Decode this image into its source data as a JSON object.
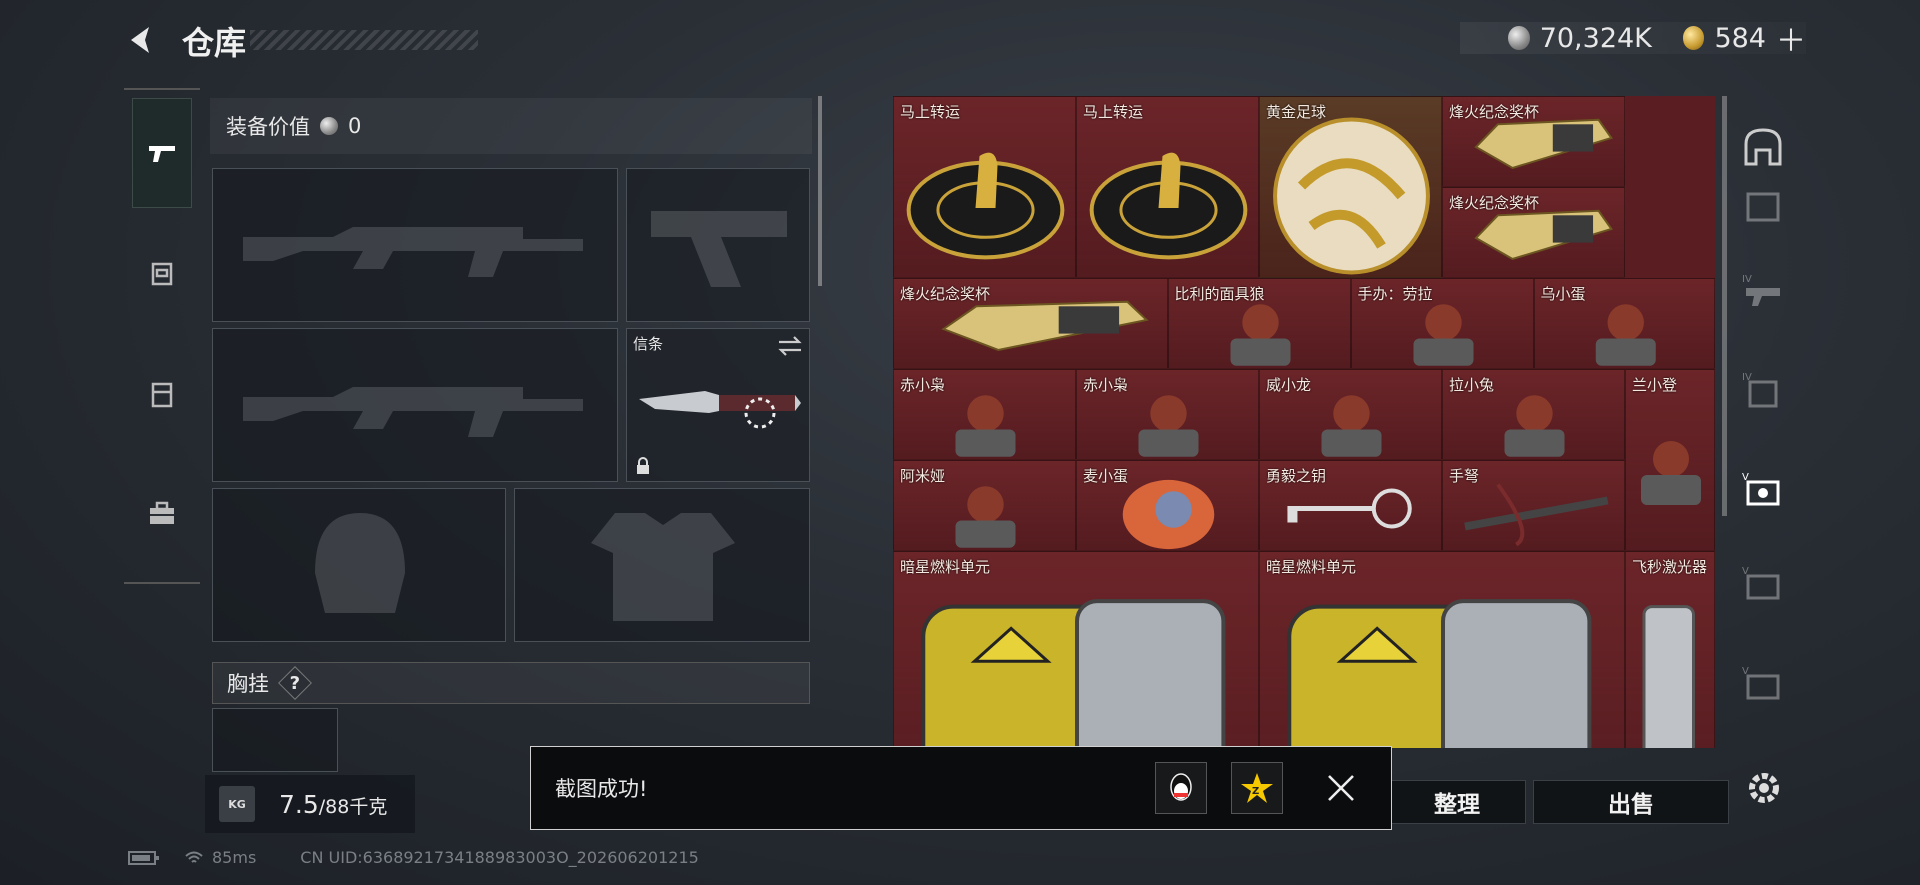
{
  "header": {
    "title": "仓库",
    "silver_amount": "70,324K",
    "gold_amount": "584",
    "add_symbol": "＋"
  },
  "equipment": {
    "value_label": "装备价值",
    "value_amount": "0",
    "melee_slot_label": "信条",
    "vest_label": "胸挂",
    "help_symbol": "?",
    "weight_current": "7.5",
    "weight_max": "/88千克",
    "weight_icon_label": "KG"
  },
  "status_bar": {
    "ping": "85ms",
    "uid": "CN UID:6368921734188983003O_202606201215"
  },
  "stash": {
    "items": [
      {
        "label": "马上转运"
      },
      {
        "label": "马上转运"
      },
      {
        "label": "黄金足球"
      },
      {
        "label": "烽火纪念奖杯"
      },
      {
        "label": "烽火纪念奖杯"
      },
      {
        "label": "烽火纪念奖杯"
      },
      {
        "label": "比利的面具狼"
      },
      {
        "label": "手办：劳拉"
      },
      {
        "label": "乌小蛋"
      },
      {
        "label": "赤小枭"
      },
      {
        "label": "赤小枭"
      },
      {
        "label": "威小龙"
      },
      {
        "label": "拉小兔"
      },
      {
        "label": "兰小登"
      },
      {
        "label": "阿米娅"
      },
      {
        "label": "麦小蛋"
      },
      {
        "label": "勇毅之钥"
      },
      {
        "label": "手弩"
      },
      {
        "label": "暗星燃料单元"
      },
      {
        "label": "暗星燃料单元"
      },
      {
        "label": "飞秒激光器"
      }
    ]
  },
  "buttons": {
    "organize": "整理",
    "sell": "出售"
  },
  "toast": {
    "message": "截图成功!"
  },
  "colors": {
    "stash_bg": "#5a1e22",
    "accent": "#4fd6b0"
  }
}
